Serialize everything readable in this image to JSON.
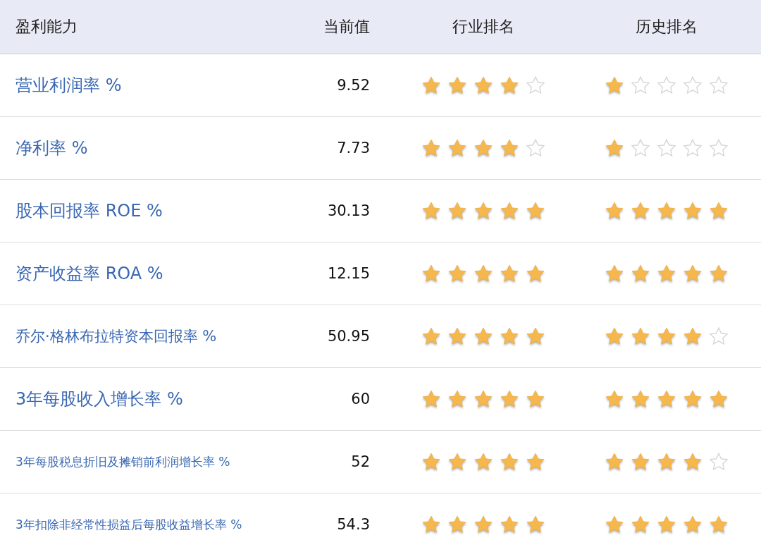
{
  "table": {
    "columns": [
      "盈利能力",
      "当前值",
      "行业排名",
      "历史排名"
    ],
    "rows": [
      {
        "name": "营业利润率 %",
        "value": "9.52",
        "industry_rank": {
          "stars": 4
        },
        "history_rank": {
          "stars": 1
        }
      },
      {
        "name": "净利率 %",
        "value": "7.73",
        "industry_rank": {
          "stars": 4
        },
        "history_rank": {
          "stars": 1
        }
      },
      {
        "name": "股本回报率 ROE %",
        "value": "30.13",
        "industry_rank": {
          "stars": 5
        },
        "history_rank": {
          "stars": 5
        }
      },
      {
        "name": "资产收益率 ROA %",
        "value": "12.15",
        "industry_rank": {
          "stars": 5
        },
        "history_rank": {
          "stars": 5
        }
      },
      {
        "name": "乔尔·格林布拉特资本回报率 %",
        "value": "50.95",
        "industry_rank": {
          "stars": 5
        },
        "history_rank": {
          "stars": 4
        }
      },
      {
        "name": "3年每股收入增长率 %",
        "value": "60",
        "industry_rank": {
          "stars": 5
        },
        "history_rank": {
          "stars": 5
        }
      },
      {
        "name": "3年每股税息折旧及摊销前利润增长率 %",
        "value": "52",
        "industry_rank": {
          "stars": 5
        },
        "history_rank": {
          "stars": 4
        }
      },
      {
        "name": "3年扣除非经常性损益后每股收益增长率 %",
        "value": "54.3",
        "industry_rank": {
          "stars": 5
        },
        "history_rank": {
          "stars": 5
        }
      }
    ]
  }
}
